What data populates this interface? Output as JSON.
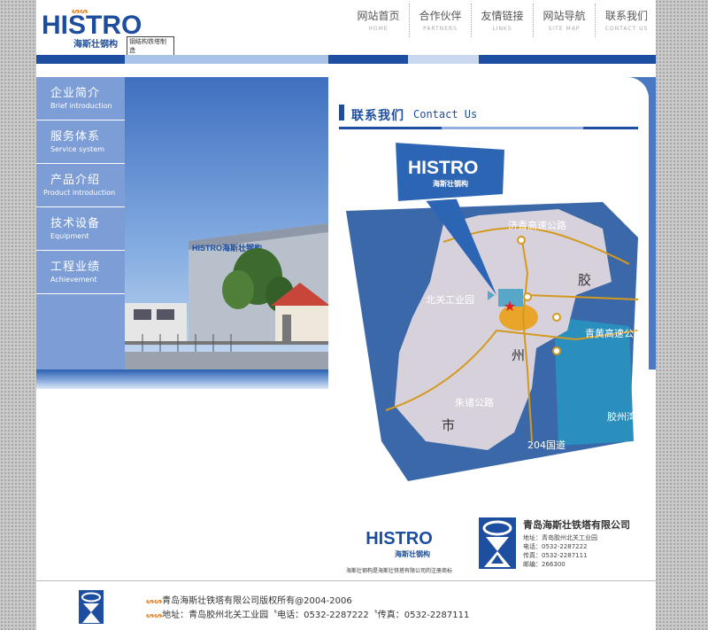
{
  "brand": {
    "logo_word": "HISTRO",
    "logo_cn": "海斯壮钢构",
    "logo_tagline": "钢结构铁塔制造"
  },
  "top_nav": [
    {
      "cn": "网站首页",
      "en": "HOME"
    },
    {
      "cn": "合作伙伴",
      "en": "PARTNERS"
    },
    {
      "cn": "友情链接",
      "en": "LINKS"
    },
    {
      "cn": "网站导航",
      "en": "SITE MAP"
    },
    {
      "cn": "联系我们",
      "en": "CONTACT US"
    }
  ],
  "side_menu": [
    {
      "cn": "企业简介",
      "en": "Brief introduction"
    },
    {
      "cn": "服务体系",
      "en": "Service system"
    },
    {
      "cn": "产品介绍",
      "en": "Product introduction"
    },
    {
      "cn": "技术设备",
      "en": "Equipment"
    },
    {
      "cn": "工程业绩",
      "en": "Achievement"
    }
  ],
  "photo": {
    "building_sign": "HISTRO海斯壮钢构"
  },
  "contact": {
    "title_cn": "联系我们",
    "title_en": "Contact Us"
  },
  "map": {
    "callout_word": "HISTRO",
    "callout_cn": "海斯壮钢构",
    "labels": {
      "jiqing": "济青高速公路",
      "beiguan": "北关工业园",
      "qinghuang": "青黄高速公路",
      "zhuzhu": "朱诸公路",
      "guodao": "204国道",
      "bay": "胶州湾",
      "c1": "胶",
      "c2": "州",
      "c3": "市"
    }
  },
  "company": {
    "brand_word": "HISTRO",
    "brand_cn": "海斯壮钢构",
    "trademark_note": "海斯壮钢构是海斯壮铁塔有限公司的注册商标",
    "name": "青岛海斯壮铁塔有限公司",
    "address": "地址：青岛胶州北关工业园",
    "phone": "电话：0532-2287222",
    "fax": "传真：0532-2287111",
    "postcode": "邮编：266300"
  },
  "footer": {
    "copyright": "青岛海斯壮铁塔有限公司版权所有@2004-2006",
    "contact_line": "地址：青岛胶州北关工业园〝电话：0532-2287222〝传真：0532-2287111"
  }
}
